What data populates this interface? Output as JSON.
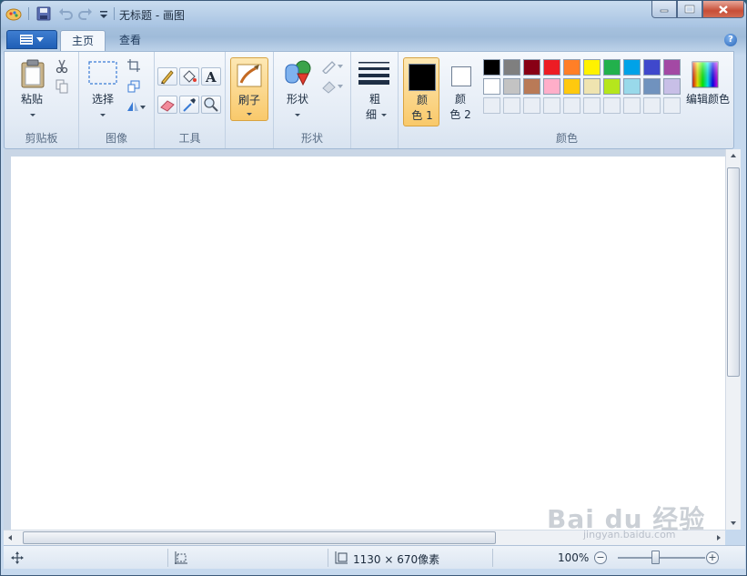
{
  "window": {
    "title": "无标题 - 画图"
  },
  "quick_access": {
    "icons": [
      "paint-app-icon",
      "save-icon",
      "undo-icon",
      "redo-icon",
      "customize-dropdown-icon"
    ]
  },
  "caption_buttons": {
    "minimize": "minimize-icon",
    "maximize": "maximize-icon",
    "close": "close-icon"
  },
  "ribbon_tabs": [
    {
      "label": "主页",
      "active": true
    },
    {
      "label": "查看",
      "active": false
    }
  ],
  "groups": {
    "clipboard": {
      "label": "剪贴板",
      "paste_label": "粘贴"
    },
    "image": {
      "label": "图像",
      "select_label": "选择"
    },
    "tools": {
      "label": "工具"
    },
    "brushes": {
      "label": "刷子"
    },
    "shapes": {
      "label": "形状",
      "shapes_label": "形状"
    },
    "size": {
      "label_line1": "粗",
      "label_line2": "细"
    },
    "colors": {
      "label": "颜色",
      "color1_line1": "颜",
      "color1_line2": "色 1",
      "color2_line1": "颜",
      "color2_line2": "色 2",
      "edit_colors": "编辑颜色",
      "color1_value": "#000000",
      "color2_value": "#ffffff",
      "palette_row1": [
        "#000000",
        "#7f7f7f",
        "#880015",
        "#ed1c24",
        "#ff7f27",
        "#fff200",
        "#22b14c",
        "#00a2e8",
        "#3f48cc",
        "#a349a4"
      ],
      "palette_row2": [
        "#ffffff",
        "#c3c3c3",
        "#b97a57",
        "#ffaec9",
        "#ffc90e",
        "#efe4b0",
        "#b5e61d",
        "#99d9ea",
        "#7092be",
        "#c8bfe7"
      ]
    }
  },
  "statusbar": {
    "canvas_size": "1130 × 670像素",
    "zoom": "100%"
  },
  "watermark": {
    "text": "Bai du 经验",
    "sub": "jingyan.baidu.com"
  }
}
